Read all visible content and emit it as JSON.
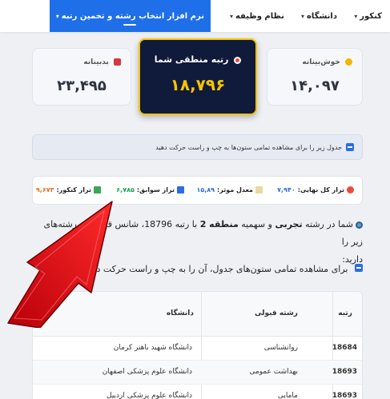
{
  "nav": {
    "items": [
      {
        "label": "کنکور",
        "chev": "▾"
      },
      {
        "label": "دانشگاه",
        "chev": "▾"
      },
      {
        "label": "نظام وظیفه",
        "chev": "▾"
      },
      {
        "label": "نرم افزار انتخاب رشته و تخمین رتبه",
        "chev": "▾"
      }
    ]
  },
  "cards": {
    "best": {
      "label": "خوش‌بینانه",
      "value": "۱۴,۰۹۷"
    },
    "logical": {
      "label": "رتبه منطقی شما",
      "value": "۱۸,۷۹۶"
    },
    "worst": {
      "label": "بدبینانه",
      "value": "۲۳,۴۹۵"
    }
  },
  "info_bar": "جدول زیر را برای مشاهده تمامی ستون‌ها به چپ و راست حرکت دهید",
  "scores": {
    "final_label": "تراز کل نهایی:",
    "final_value": "۷,۹۴۰",
    "gpa_label": "معدل موثر:",
    "gpa_value": "۱۵,۸۹",
    "history_label": "تراز سوابق:",
    "history_value": "۶,۷۸۵",
    "konkur_label": "تراز کنکور:",
    "konkur_value": "۹,۶۷۳"
  },
  "main": {
    "p1_a": "شما در رشته ",
    "p1_field": "تجربی",
    "p1_b": " و سهمیه ",
    "p1_quota": "منطقه 2",
    "p1_c": " با رتبه 18796، شانس قبولی در رشته‌های زیر را",
    "p1_d": "دارید:",
    "p2": "برای مشاهده تمامی ستون‌های جدول، آن را به چپ و راست حرکت دهید"
  },
  "table": {
    "headers": {
      "rank": "رتبه",
      "field": "رشته قبولی",
      "uni": "دانشگاه"
    },
    "rows": [
      {
        "rank": "18684",
        "field": "روانشناسی",
        "uni": "دانشگاه شهید باهنر کرمان"
      },
      {
        "rank": "18693",
        "field": "بهداشت عمومی",
        "uni": "دانشگاه علوم پزشکی اصفهان"
      },
      {
        "rank": "18693",
        "field": "مامایی",
        "uni": "دانشگاه علوم پزشکی اردبیل"
      }
    ]
  },
  "colors": {
    "accent": "#1e6fe8",
    "gold": "#f6c300",
    "navy": "#101a3a",
    "arrow": "#e3141b"
  }
}
